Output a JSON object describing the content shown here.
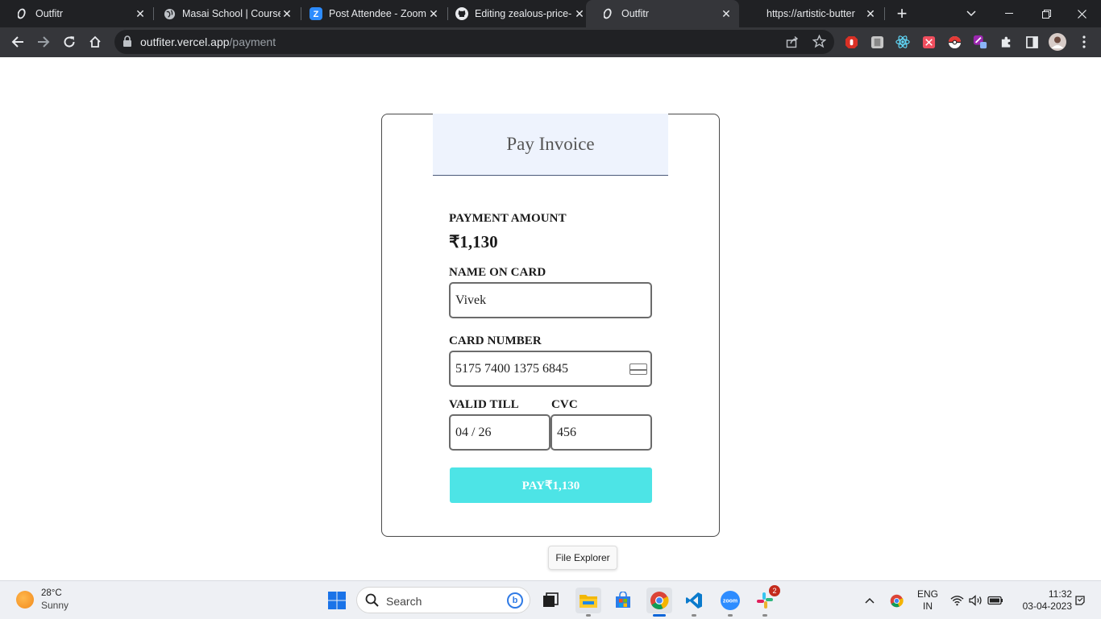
{
  "browser": {
    "tabs": [
      {
        "title": "Outfitr",
        "icon": "outfitr-logo-icon",
        "active": false
      },
      {
        "title": "Masai School | Course",
        "icon": "globe-icon",
        "active": false
      },
      {
        "title": "Post Attendee - Zoom",
        "icon": "zoom-icon",
        "active": false
      },
      {
        "title": "Editing zealous-price-",
        "icon": "github-icon",
        "active": false
      },
      {
        "title": "Outfitr",
        "icon": "outfitr-logo-icon",
        "active": true
      },
      {
        "title": "https://artistic-butter",
        "icon": "none",
        "active": false
      }
    ],
    "new_tab_glyph": "+",
    "url_host": "outfiter.vercel.app",
    "url_path": "/payment"
  },
  "payment": {
    "header_title": "Pay Invoice",
    "amount_label": "PAYMENT AMOUNT",
    "amount_value": "₹1,130",
    "name_label": "NAME ON CARD",
    "name_value": "Vivek",
    "card_label": "CARD NUMBER",
    "card_value": "5175 7400 1375 6845",
    "valid_label": "VALID TILL",
    "valid_value": "04 / 26",
    "cvc_label": "CVC",
    "cvc_value": "456",
    "pay_button": "PAY₹1,130"
  },
  "tooltip": "File Explorer",
  "taskbar": {
    "weather_temp": "28°C",
    "weather_desc": "Sunny",
    "search_placeholder": "Search",
    "slack_badge": "2",
    "lang_line1": "ENG",
    "lang_line2": "IN",
    "time": "11:32",
    "date": "03-04-2023"
  },
  "colors": {
    "accent_button": "#4de4e6",
    "header_bg": "#eef3fd",
    "tab_strip": "#202124",
    "toolbar": "#35363a"
  }
}
